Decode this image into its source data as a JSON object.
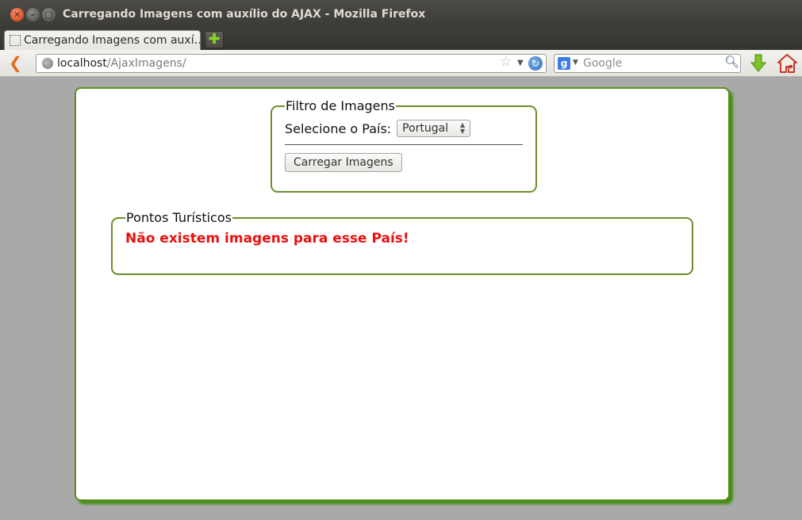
{
  "window": {
    "title": "Carregando Imagens com auxílio do AJAX - Mozilla Firefox"
  },
  "tabs": [
    {
      "label": "Carregando Imagens com auxí…"
    }
  ],
  "navbar": {
    "url_host": "localhost",
    "url_path": "/AjaxImagens/",
    "search_engine_icon": "g",
    "search_placeholder": "Google"
  },
  "filtro": {
    "legend": "Filtro de Imagens",
    "country_label": "Selecione o País:",
    "country_selected": "Portugal",
    "load_button": "Carregar Imagens"
  },
  "pontos": {
    "legend": "Pontos Turísticos",
    "message": "Não existem imagens para esse País!",
    "message_color": "#e8100e"
  },
  "colors": {
    "border_green": "#5e8c1f",
    "shadow_green": "#3f8f14",
    "background_gray": "#a9a9a9"
  }
}
